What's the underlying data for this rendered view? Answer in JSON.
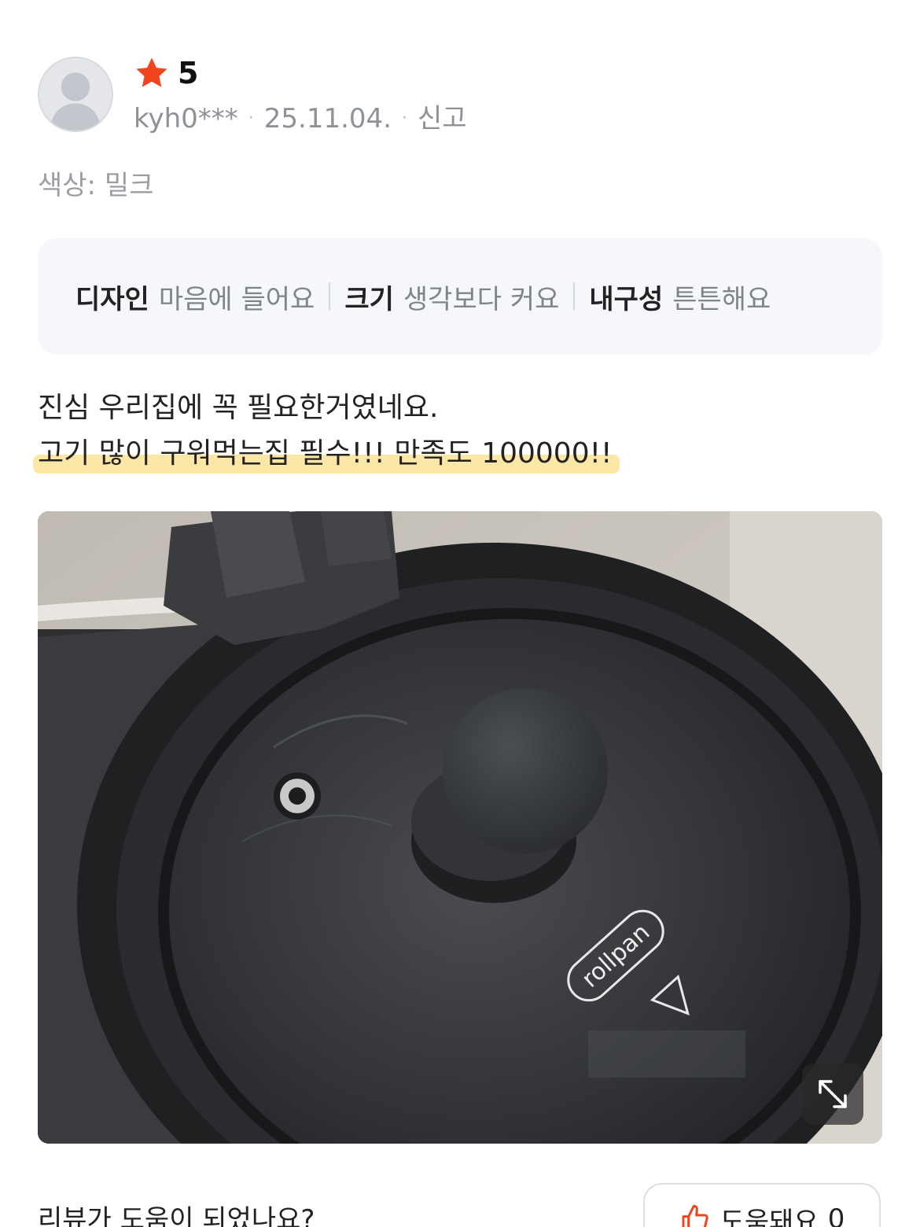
{
  "review": {
    "rating_value": "5",
    "user": "kyh0***",
    "date": "25.11.04.",
    "report_label": "신고",
    "meta_separator": "·",
    "option_text": "색상: 밀크",
    "tags": [
      {
        "key": "디자인",
        "value": "마음에 들어요"
      },
      {
        "key": "크기",
        "value": "생각보다 커요"
      },
      {
        "key": "내구성",
        "value": "튼튼해요"
      }
    ],
    "text_line1": "진심 우리집에 꼭 필요한거였네요.",
    "text_line2": "고기 많이 구워먹는집 필수!!! 만족도 100000!!",
    "photo": {
      "brand_text": "rollpan"
    }
  },
  "footer": {
    "question": "리뷰가 도움이 되었나요?",
    "helpful_label": "도움돼요",
    "helpful_count": "0"
  },
  "icons": {
    "star": "star-icon",
    "avatar": "user-silhouette-icon",
    "expand": "expand-diagonal-icon",
    "thumb": "thumbs-up-icon"
  },
  "colors": {
    "star": "#f2441d",
    "highlight": "#fde7a6",
    "tag_box_bg": "#f6f7fa",
    "muted_text": "#8d9198"
  }
}
